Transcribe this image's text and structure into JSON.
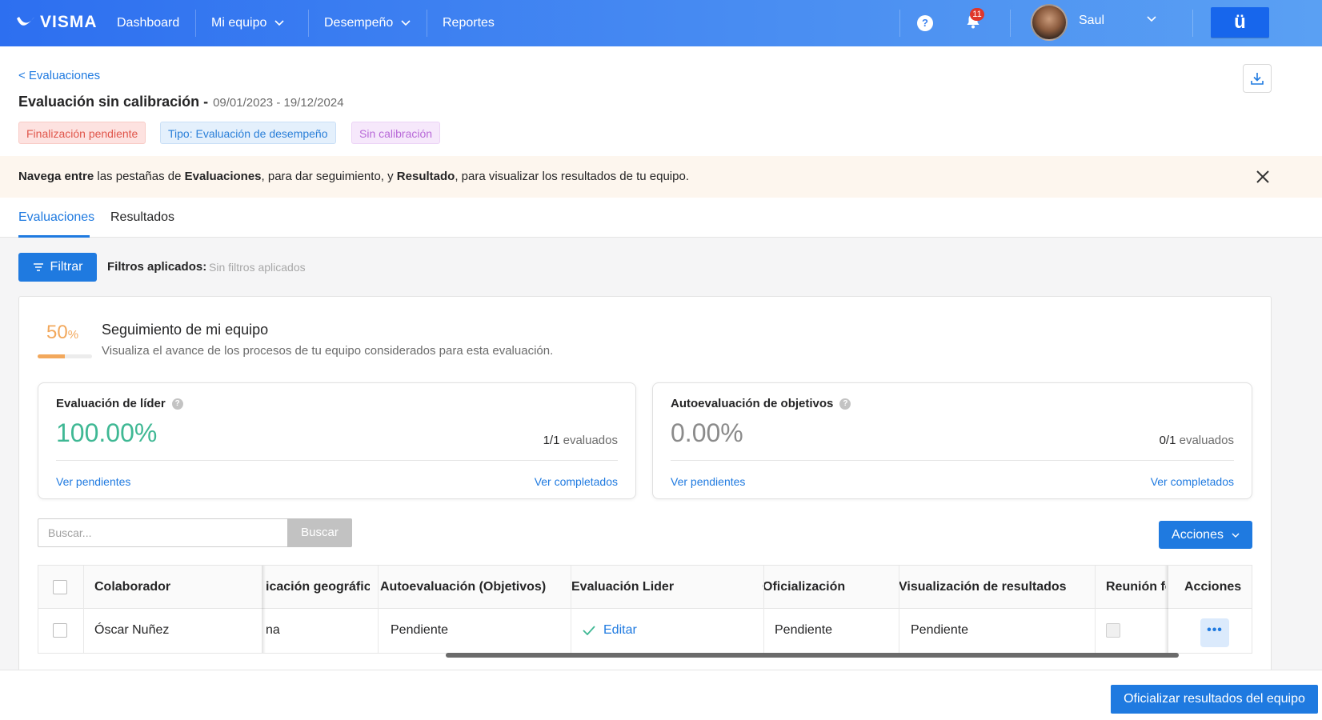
{
  "nav": {
    "brand": "VISMA",
    "items": [
      {
        "label": "Dashboard"
      },
      {
        "label": "Mi equipo"
      },
      {
        "label": "Desempeño"
      },
      {
        "label": "Reportes"
      }
    ],
    "notifications_count": "11",
    "help_glyph": "?",
    "user_name": "Saul",
    "app_glyph": "ü"
  },
  "header": {
    "back_label": "< Evaluaciones",
    "title": "Evaluación sin calibración -",
    "dates": "09/01/2023 - 19/12/2024",
    "tags": [
      {
        "label": "Finalización pendiente"
      },
      {
        "label": "Tipo: Evaluación de desempeño"
      },
      {
        "label": "Sin calibración"
      }
    ]
  },
  "banner": {
    "part1": "Navega entre",
    "part2": " las pestañas de ",
    "part3": "Evaluaciones",
    "part4": ", para dar seguimiento, y ",
    "part5": "Resultado",
    "part6": ", para visualizar los resultados de tu equipo."
  },
  "tabs": [
    {
      "label": "Evaluaciones",
      "active": true
    },
    {
      "label": "Resultados",
      "active": false
    }
  ],
  "filters": {
    "button_label": "Filtrar",
    "applied_label": "Filtros aplicados:",
    "applied_value": "Sin filtros aplicados"
  },
  "tracking": {
    "percent_number": "50",
    "percent_sign": "%",
    "progress": 0.5,
    "title": "Seguimiento de mi equipo",
    "subtitle": "Visualiza el avance de los procesos de tu equipo considerados para esta evaluación."
  },
  "kpis": [
    {
      "title": "Evaluación de líder",
      "value": "100.00%",
      "count_bold": "1/1",
      "count_rest": " evaluados",
      "link_pending": "Ver pendientes",
      "link_done": "Ver completados",
      "color": "#3fb894"
    },
    {
      "title": "Autoevaluación de objetivos",
      "value": "0.00%",
      "count_bold": "0/1",
      "count_rest": " evaluados",
      "link_pending": "Ver pendientes",
      "link_done": "Ver completados",
      "color": "#8b8b8b"
    }
  ],
  "search": {
    "placeholder": "Buscar...",
    "button_label": "Buscar"
  },
  "actions_label": "Acciones",
  "table": {
    "headers": [
      "Colaborador",
      "icación geográfica",
      "Autoevaluación (Objetivos)",
      "Evaluación Lider",
      "Oficialización",
      "Visualización de resultados",
      "Reunión fe",
      "Acciones"
    ],
    "row": {
      "colaborador": "Óscar Nuñez",
      "ubicacion": "na",
      "autoevaluacion": "Pendiente",
      "evaluacion_lider": "Editar",
      "oficializacion": "Pendiente",
      "visualizacion": "Pendiente",
      "acciones_glyph": "•••"
    }
  },
  "footer": {
    "officialize_label": "Oficializar resultados del equipo"
  }
}
